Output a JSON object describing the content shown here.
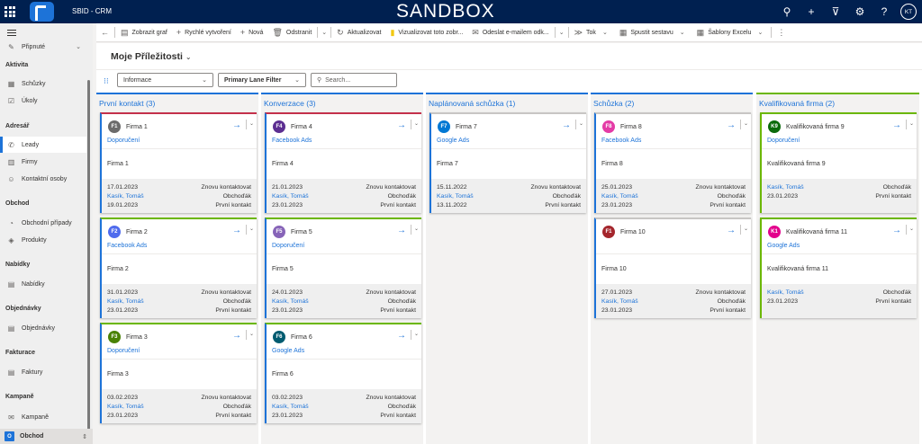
{
  "app": {
    "title": "SBID - CRM",
    "banner": "SANDBOX",
    "avatar_initials": "KT"
  },
  "command_bar": [
    {
      "label": "Zobrazit graf",
      "icon": "chart-icon"
    },
    {
      "label": "Rychlé vytvoření",
      "icon": "plus-icon"
    },
    {
      "label": "Nová",
      "icon": "plus-icon"
    },
    {
      "label": "Odstranit",
      "icon": "trash-icon"
    },
    {
      "label": "Aktualizovat",
      "icon": "refresh-icon"
    },
    {
      "label": "Vizualizovat toto zobr...",
      "icon": "visualize-icon"
    },
    {
      "label": "Odeslat e-mailem odk...",
      "icon": "email-icon"
    },
    {
      "label": "Tok",
      "icon": "flow-icon"
    },
    {
      "label": "Spustit sestavu",
      "icon": "report-icon"
    },
    {
      "label": "Šablony Excelu",
      "icon": "excel-icon"
    }
  ],
  "sidebar": {
    "pinned": "Připnuté",
    "groups": [
      {
        "heading": "Aktivita",
        "items": [
          "Schůzky",
          "Úkoly"
        ]
      },
      {
        "heading": "Adresář",
        "items": [
          "Leady",
          "Firmy",
          "Kontaktní osoby"
        ]
      },
      {
        "heading": "Obchod",
        "items": [
          "Obchodní případy",
          "Produkty"
        ]
      },
      {
        "heading": "Nabídky",
        "items": [
          "Nabídky"
        ]
      },
      {
        "heading": "Objednávky",
        "items": [
          "Objednávky"
        ]
      },
      {
        "heading": "Fakturace",
        "items": [
          "Faktury"
        ]
      },
      {
        "heading": "Kampaně",
        "items": [
          "Kampaně"
        ]
      }
    ],
    "area": {
      "badge": "O",
      "label": "Obchod"
    }
  },
  "view": {
    "title": "Moje Příležitosti",
    "form_select": "Informace",
    "filter_button": "Primary Lane Filter",
    "search_placeholder": "Search..."
  },
  "lanes": [
    {
      "title": "První kontakt (3)",
      "cards": [
        {
          "initials": "F1",
          "color": "#6b6b6b",
          "stripe": "#c4314b",
          "name": "Firma 1",
          "source": "Doporučení",
          "body": "Firma 1",
          "d1": "17.01.2023",
          "s1": "Znovu kontaktovat",
          "owner": "Kasík, Tomáš",
          "role": "Obchoďák",
          "d2": "19.01.2023",
          "stage": "První kontakt"
        },
        {
          "initials": "F2",
          "color": "#4f6bed",
          "stripe": "#6bb700",
          "name": "Firma 2",
          "source": "Facebook Ads",
          "body": "Firma 2",
          "d1": "31.01.2023",
          "s1": "Znovu kontaktovat",
          "owner": "Kasík, Tomáš",
          "role": "Obchoďák",
          "d2": "23.01.2023",
          "stage": "První kontakt"
        },
        {
          "initials": "F3",
          "color": "#498205",
          "stripe": "#6bb700",
          "name": "Firma 3",
          "source": "Doporučení",
          "body": "Firma 3",
          "d1": "03.02.2023",
          "s1": "Znovu kontaktovat",
          "owner": "Kasík, Tomáš",
          "role": "Obchoďák",
          "d2": "23.01.2023",
          "stage": "První kontakt"
        }
      ]
    },
    {
      "title": "Konverzace (3)",
      "cards": [
        {
          "initials": "F4",
          "color": "#5c2e91",
          "stripe": "#c4314b",
          "name": "Firma 4",
          "source": "Facebook Ads",
          "body": "Firma 4",
          "d1": "21.01.2023",
          "s1": "Znovu kontaktovat",
          "owner": "Kasík, Tomáš",
          "role": "Obchoďák",
          "d2": "23.01.2023",
          "stage": "První kontakt"
        },
        {
          "initials": "F5",
          "color": "#8764b8",
          "stripe": "#6bb700",
          "name": "Firma 5",
          "source": "Doporučení",
          "body": "Firma 5",
          "d1": "24.01.2023",
          "s1": "Znovu kontaktovat",
          "owner": "Kasík, Tomáš",
          "role": "Obchoďák",
          "d2": "23.01.2023",
          "stage": "První kontakt"
        },
        {
          "initials": "F6",
          "color": "#005b70",
          "stripe": "#6bb700",
          "name": "Firma 6",
          "source": "Google Ads",
          "body": "Firma 6",
          "d1": "03.02.2023",
          "s1": "Znovu kontaktovat",
          "owner": "Kasík, Tomáš",
          "role": "Obchoďák",
          "d2": "23.01.2023",
          "stage": "První kontakt"
        }
      ]
    },
    {
      "title": "Naplánovaná schůzka (1)",
      "cards": [
        {
          "initials": "F7",
          "color": "#0078d4",
          "stripe": "#c8c6c4",
          "name": "Firma 7",
          "source": "Google Ads",
          "body": "Firma 7",
          "d1": "15.11.2022",
          "s1": "Znovu kontaktovat",
          "owner": "Kasík, Tomáš",
          "role": "Obchoďák",
          "d2": "13.11.2022",
          "stage": "První kontakt"
        }
      ]
    },
    {
      "title": "Schůzka (2)",
      "cards": [
        {
          "initials": "F8",
          "color": "#e43ba6",
          "stripe": "#c8c6c4",
          "name": "Firma 8",
          "source": "Facebook Ads",
          "body": "Firma 8",
          "d1": "25.01.2023",
          "s1": "Znovu kontaktovat",
          "owner": "Kasík, Tomáš",
          "role": "Obchoďák",
          "d2": "23.01.2023",
          "stage": "První kontakt"
        },
        {
          "initials": "F1",
          "color": "#a4262c",
          "stripe": "#c8c6c4",
          "name": "Firma 10",
          "source": "",
          "body": "Firma 10",
          "d1": "27.01.2023",
          "s1": "Znovu kontaktovat",
          "owner": "Kasík, Tomáš",
          "role": "Obchoďák",
          "d2": "23.01.2023",
          "stage": "První kontakt"
        }
      ]
    },
    {
      "title": "Kvalifikovaná firma (2)",
      "cards": [
        {
          "initials": "K9",
          "color": "#0b6a0b",
          "stripe": "#6bb700",
          "name": "Kvalifikovaná firma 9",
          "source": "Doporučení",
          "body": "Kvalifikovaná firma 9",
          "d1": "",
          "s1": "",
          "owner": "Kasík, Tomáš",
          "role": "Obchoďák",
          "d2": "23.01.2023",
          "stage": "První kontakt"
        },
        {
          "initials": "K1",
          "color": "#e3008c",
          "stripe": "#6bb700",
          "name": "Kvalifikovaná firma 11",
          "source": "Google Ads",
          "body": "Kvalifikovaná firma 11",
          "d1": "",
          "s1": "",
          "owner": "Kasík, Tomáš",
          "role": "Obchoďák",
          "d2": "23.01.2023",
          "stage": "První kontakt"
        }
      ]
    }
  ]
}
